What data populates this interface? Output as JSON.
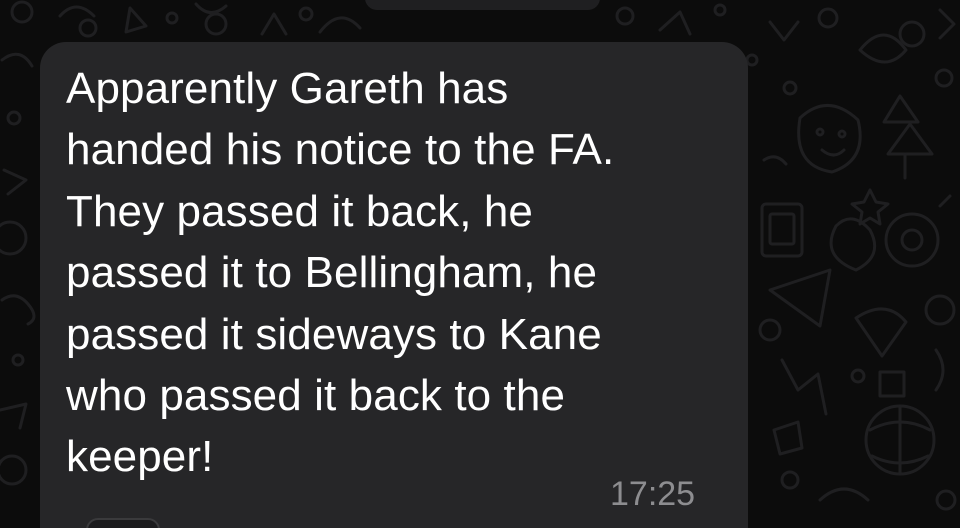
{
  "message": {
    "text": "Apparently Gareth has\nhanded his notice to the FA.\nThey passed it back, he\npassed it to Bellingham, he\npassed it sideways to Kane\nwho passed it back to the\nkeeper!",
    "time": "17:25"
  },
  "colors": {
    "background": "#0c0c0c",
    "bubble": "#262628",
    "text": "#ffffff",
    "timestamp": "#8d8d90",
    "doodle": "#1e1e20"
  },
  "icons": [
    "chat-wallpaper-doodles"
  ]
}
